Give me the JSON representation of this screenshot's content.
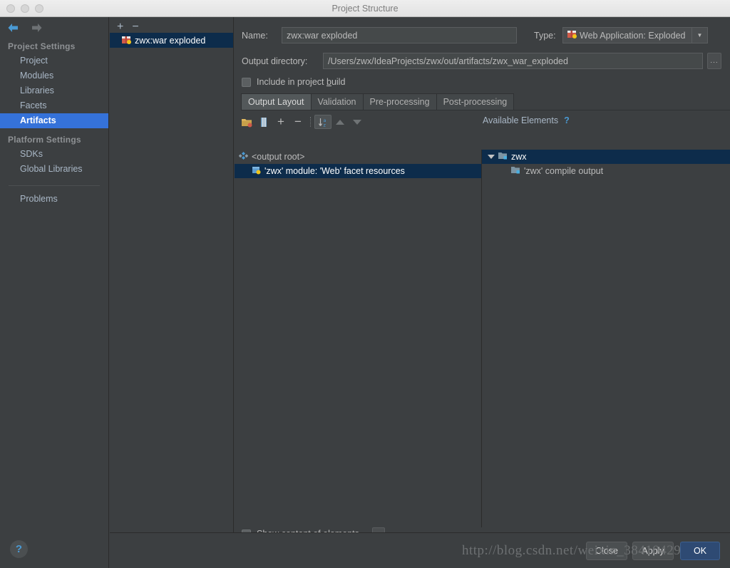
{
  "window": {
    "title": "Project Structure",
    "traffic_lights": [
      "close",
      "minimize",
      "zoom"
    ]
  },
  "sidebar": {
    "nav": {
      "back_icon": "arrow-left-icon",
      "forward_icon": "arrow-right-icon"
    },
    "groups": [
      {
        "heading": "Project Settings",
        "items": [
          {
            "label": "Project",
            "selected": false
          },
          {
            "label": "Modules",
            "selected": false
          },
          {
            "label": "Libraries",
            "selected": false
          },
          {
            "label": "Facets",
            "selected": false
          },
          {
            "label": "Artifacts",
            "selected": true
          }
        ]
      },
      {
        "heading": "Platform Settings",
        "items": [
          {
            "label": "SDKs",
            "selected": false
          },
          {
            "label": "Global Libraries",
            "selected": false
          }
        ]
      }
    ],
    "problems": {
      "label": "Problems"
    },
    "help_button": {
      "glyph": "?",
      "name": "help-icon"
    }
  },
  "artifacts_panel": {
    "toolbar": {
      "add": "+",
      "remove": "−"
    },
    "items": [
      {
        "label": "zwx:war exploded",
        "icon": "artifact-icon",
        "selected": true
      }
    ]
  },
  "main": {
    "name_field": {
      "label": "Name:",
      "value": "zwx:war exploded",
      "placeholder": ""
    },
    "type_field": {
      "label": "Type:",
      "value": "Web Application: Exploded",
      "icon": "artifact-icon",
      "arrow_icon": "chevron-down-icon"
    },
    "output_directory": {
      "label": "Output directory:",
      "value": "/Users/zwx/IdeaProjects/zwx/out/artifacts/zwx_war_exploded",
      "browse_label": "..."
    },
    "include_in_build": {
      "label": "Include in project build",
      "underline": "b",
      "checked": false
    },
    "tabs": [
      {
        "label": "Output Layout",
        "active": true
      },
      {
        "label": "Validation",
        "active": false
      },
      {
        "label": "Pre-processing",
        "active": false
      },
      {
        "label": "Post-processing",
        "active": false
      }
    ],
    "tree_toolbar": {
      "icons": [
        {
          "name": "add-directory-icon"
        },
        {
          "name": "add-archive-icon"
        },
        {
          "name": "add-copy-icon"
        },
        {
          "name": "remove-icon"
        },
        {
          "name": "sort-alphabetically-icon"
        },
        {
          "name": "move-up-icon"
        },
        {
          "name": "move-down-icon"
        }
      ],
      "plus": "+",
      "minus": "−",
      "sort_az": "↓ᵃ₂"
    },
    "output_layout_tree": [
      {
        "label": "<output root>",
        "icon": "output-root-icon",
        "indent": 0,
        "selected": false
      },
      {
        "label": "'zwx' module: 'Web' facet resources",
        "icon": "module-resources-icon",
        "indent": 1,
        "selected": true
      }
    ],
    "available_elements": {
      "title": "Available Elements",
      "help_glyph": "?",
      "tree": [
        {
          "label": "zwx",
          "icon": "module-icon",
          "indent": 0,
          "expanded": true,
          "selected": true
        },
        {
          "label": "'zwx' compile output",
          "icon": "compile-output-icon",
          "indent": 1,
          "expanded": false,
          "selected": false
        }
      ]
    },
    "show_content": {
      "label": "Show content of elements",
      "checked": false,
      "dots_label": "..."
    }
  },
  "footer": {
    "buttons": [
      {
        "label": "Close",
        "primary": false
      },
      {
        "label": "Apply",
        "primary": false
      },
      {
        "label": "OK",
        "primary": true
      }
    ],
    "watermark": "http://blog.csdn.net/weixin_38410429"
  }
}
